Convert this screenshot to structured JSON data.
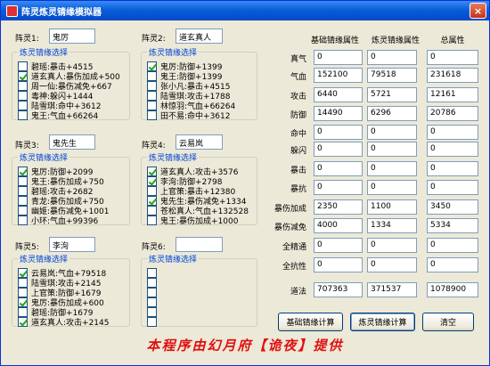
{
  "window": {
    "title": "阵灵炼灵锖缘模拟器",
    "close": "×"
  },
  "group_title": "炼灵锖缘选择",
  "spirits": [
    {
      "label": "阵灵1:",
      "name": "鬼厉",
      "items": [
        {
          "text": "碧瑶:暴击+4515",
          "checked": false
        },
        {
          "text": "道玄真人:暴伤加成+500",
          "checked": true
        },
        {
          "text": "周一仙:暴伤减免+667",
          "checked": false
        },
        {
          "text": "毒神:躲闪+1444",
          "checked": false
        },
        {
          "text": "陆雪琪:命中+3612",
          "checked": false
        },
        {
          "text": "鬼王:气血+66264",
          "checked": false
        }
      ]
    },
    {
      "label": "阵灵2:",
      "name": "道玄真人",
      "items": [
        {
          "text": "鬼厉:防御+1399",
          "checked": true
        },
        {
          "text": "鬼王:防御+1399",
          "checked": false
        },
        {
          "text": "张小凡:暴击+4515",
          "checked": false
        },
        {
          "text": "陆雪琪:攻击+1788",
          "checked": false
        },
        {
          "text": "林惊羽:气血+66264",
          "checked": false
        },
        {
          "text": "田不易:命中+3612",
          "checked": false
        }
      ]
    },
    {
      "label": "阵灵3:",
      "name": "鬼先生",
      "items": [
        {
          "text": "鬼厉:防御+2099",
          "checked": true
        },
        {
          "text": "鬼王:暴伤加成+750",
          "checked": false
        },
        {
          "text": "碧瑶:攻击+2682",
          "checked": false
        },
        {
          "text": "青龙:暴伤加成+750",
          "checked": false
        },
        {
          "text": "幽姬:暴伤减免+1001",
          "checked": false
        },
        {
          "text": "小环:气血+99396",
          "checked": false
        }
      ]
    },
    {
      "label": "阵灵4:",
      "name": "云易岚",
      "items": [
        {
          "text": "道玄真人:攻击+3576",
          "checked": true
        },
        {
          "text": "李洵:防御+2798",
          "checked": true
        },
        {
          "text": "上官策:暴击+12380",
          "checked": false
        },
        {
          "text": "鬼先生:暴伤减免+1334",
          "checked": true
        },
        {
          "text": "苍松真人:气血+132528",
          "checked": false
        },
        {
          "text": "鬼王:暴伤加成+1000",
          "checked": false
        }
      ]
    },
    {
      "label": "阵灵5:",
      "name": "李洵",
      "items": [
        {
          "text": "云易岚:气血+79518",
          "checked": true
        },
        {
          "text": "陆雪琪:攻击+2145",
          "checked": false
        },
        {
          "text": "上官策:防御+1679",
          "checked": false
        },
        {
          "text": "鬼厉:暴伤加成+600",
          "checked": true
        },
        {
          "text": "碧瑶:防御+1679",
          "checked": false
        },
        {
          "text": "道玄真人:攻击+2145",
          "checked": true
        }
      ]
    },
    {
      "label": "阵灵6:",
      "name": "",
      "items": [
        {
          "text": "",
          "checked": false
        },
        {
          "text": "",
          "checked": false
        },
        {
          "text": "",
          "checked": false
        },
        {
          "text": "",
          "checked": false
        },
        {
          "text": "",
          "checked": false
        },
        {
          "text": "",
          "checked": false
        }
      ]
    }
  ],
  "stats": {
    "headers": [
      "基础锖缘属性",
      "炼灵锖缘属性",
      "总属性"
    ],
    "rows": [
      {
        "label": "真气",
        "values": [
          "0",
          "0",
          "0"
        ]
      },
      {
        "label": "气血",
        "values": [
          "152100",
          "79518",
          "231618"
        ]
      },
      {
        "label": "攻击",
        "values": [
          "6440",
          "5721",
          "12161"
        ]
      },
      {
        "label": "防御",
        "values": [
          "14490",
          "6296",
          "20786"
        ]
      },
      {
        "label": "命中",
        "values": [
          "0",
          "0",
          "0"
        ]
      },
      {
        "label": "躲闪",
        "values": [
          "0",
          "0",
          "0"
        ]
      },
      {
        "label": "暴击",
        "values": [
          "0",
          "0",
          "0"
        ]
      },
      {
        "label": "暴抗",
        "values": [
          "0",
          "0",
          "0"
        ]
      },
      {
        "label": "暴伤加成",
        "values": [
          "2350",
          "1100",
          "3450"
        ]
      },
      {
        "label": "暴伤减免",
        "values": [
          "4000",
          "1334",
          "5334"
        ]
      },
      {
        "label": "全精通",
        "values": [
          "0",
          "0",
          "0"
        ]
      },
      {
        "label": "全抗性",
        "values": [
          "0",
          "0",
          "0"
        ]
      },
      {
        "label": "道法",
        "values": [
          "707363",
          "371537",
          "1078900"
        ]
      }
    ]
  },
  "buttons": {
    "basic": "基础锖缘计算",
    "refine": "炼灵锖缘计算",
    "clear": "清空"
  },
  "footer": "本程序由幻月府【诡夜】提供"
}
